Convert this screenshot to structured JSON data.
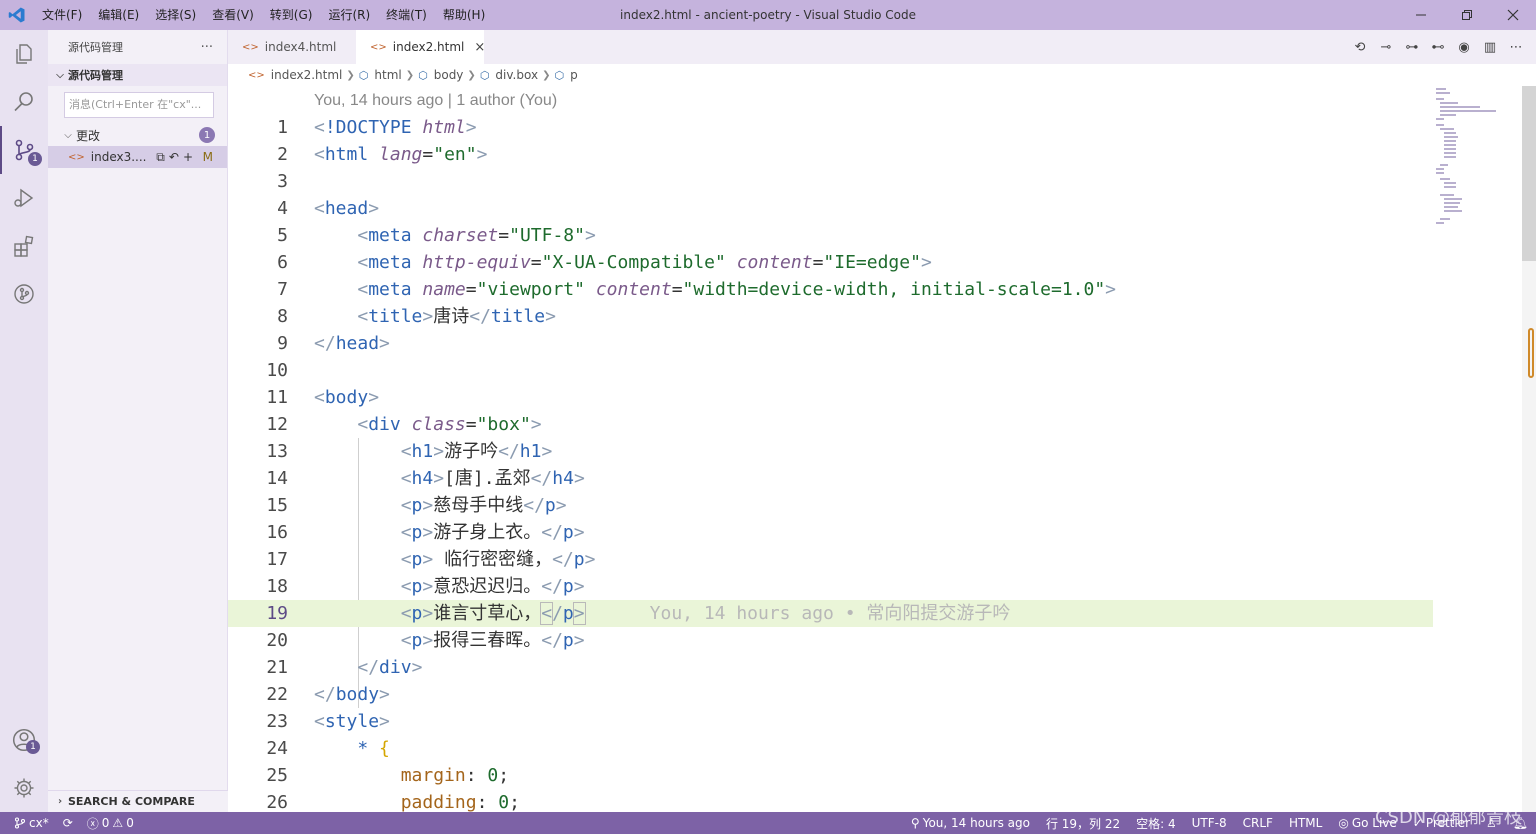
{
  "titlebar": {
    "menus": [
      "文件(F)",
      "编辑(E)",
      "选择(S)",
      "查看(V)",
      "转到(G)",
      "运行(R)",
      "终端(T)",
      "帮助(H)"
    ],
    "title": "index2.html - ancient-poetry - Visual Studio Code",
    "colors": {
      "background": "#c5b3dd"
    }
  },
  "activitybar": {
    "items": [
      "explorer-icon",
      "search-icon",
      "source-control-icon",
      "run-debug-icon",
      "extensions-icon",
      "git-graph-icon"
    ],
    "source_control_badge": "1",
    "accounts_badge": "1"
  },
  "sidebar": {
    "header_title": "源代码管理",
    "more_label": "···",
    "section_title": "源代码管理",
    "message_placeholder": "消息(Ctrl+Enter 在\"cx\"...",
    "changes_label": "更改",
    "changes_count": "1",
    "file": {
      "name": "index3....",
      "status": "M"
    },
    "search_compare_label": "SEARCH & COMPARE"
  },
  "editor": {
    "tabs": [
      {
        "label": "index4.html",
        "active": false
      },
      {
        "label": "index2.html",
        "active": true,
        "close": "×"
      }
    ],
    "breadcrumb": [
      "index2.html",
      "html",
      "body",
      "div.box",
      "p"
    ],
    "blame_header": "You, 14 hours ago | 1 author (You)",
    "line_numbers": [
      "1",
      "2",
      "3",
      "4",
      "5",
      "6",
      "7",
      "8",
      "9",
      "10",
      "11",
      "12",
      "13",
      "14",
      "15",
      "16",
      "17",
      "18",
      "19",
      "20",
      "21",
      "22",
      "23",
      "24",
      "25",
      "26"
    ],
    "current_line": "19",
    "inline_blame": "You, 14 hours ago • 常向阳提交游子吟"
  },
  "statusbar": {
    "branch": "cx*",
    "errors": "0",
    "warnings": "0",
    "blame": "You, 14 hours ago",
    "position": "行 19，列 22",
    "spaces": "空格: 4",
    "encoding": "UTF-8",
    "eol": "CRLF",
    "language": "HTML",
    "go_live": "Go Live",
    "prettier": "Prettier",
    "colors": {
      "background": "#7d62a6"
    }
  },
  "watermark": "CSDN @郁郁青枝"
}
